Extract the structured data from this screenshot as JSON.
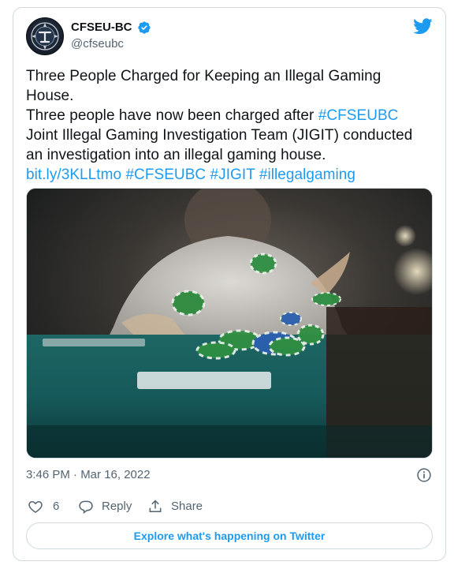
{
  "account": {
    "display_name": "CFSEU-BC",
    "handle": "@cfseubc",
    "verified": true,
    "avatar_icon": "cfseu-bc-badge-logo"
  },
  "brand": {
    "icon": "twitter-bird-icon",
    "color": "#1d9bf0"
  },
  "tweet": {
    "line1": "Three People Charged for Keeping an Illegal Gaming House.",
    "line2_prefix": "Three people have now been charged after ",
    "hashtag_mention": "#CFSEUBC",
    "line2_rest": " Joint Illegal Gaming Investigation Team (JIGIT) conducted an investigation into an illegal gaming house.",
    "link": "bit.ly/3KLLtmo",
    "hashtags": [
      "#CFSEUBC",
      "#JIGIT",
      "#illegalgaming"
    ]
  },
  "media": {
    "description_icon": "poker-chips-photo"
  },
  "meta": {
    "timestamp": "3:46 PM · Mar 16, 2022"
  },
  "actions": {
    "like_count": "6",
    "reply_label": "Reply",
    "share_label": "Share"
  },
  "explore_label": "Explore what's happening on Twitter"
}
